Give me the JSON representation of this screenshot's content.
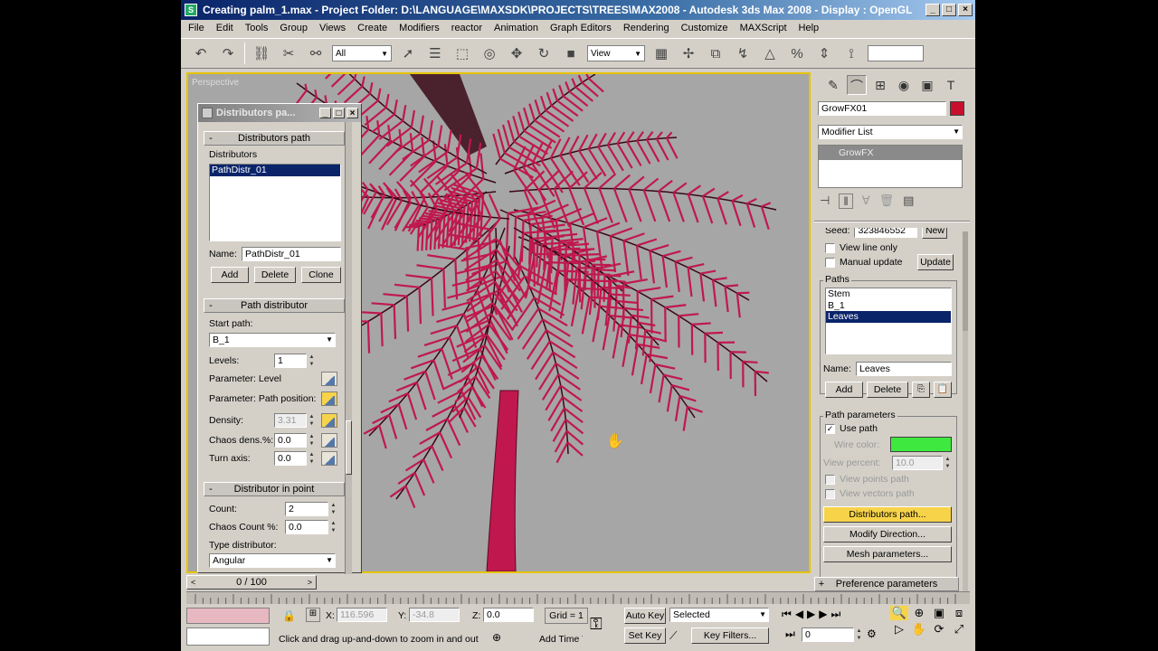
{
  "window": {
    "title": "Creating palm_1.max    - Project Folder: D:\\LANGUAGE\\MAXSDK\\PROJECTS\\TREES\\MAX2008    - Autodesk 3ds Max 2008    - Display : OpenGL",
    "app_icon": "S"
  },
  "menu": [
    "File",
    "Edit",
    "Tools",
    "Group",
    "Views",
    "Create",
    "Modifiers",
    "reactor",
    "Animation",
    "Graph Editors",
    "Rendering",
    "Customize",
    "MAXScript",
    "Help"
  ],
  "toolbar": {
    "selection_filter": "All",
    "ref_coord": "View"
  },
  "viewport": {
    "label": "Perspective",
    "foliage_color": "#c0184e",
    "background_color": "#a6a6a6"
  },
  "dialog": {
    "title": "Distributors pa...",
    "rollout1": {
      "header": "Distributors path",
      "list_label": "Distributors",
      "items": [
        "PathDistr_01"
      ],
      "name_label": "Name:",
      "name_value": "PathDistr_01",
      "add": "Add",
      "delete": "Delete",
      "clone": "Clone"
    },
    "rollout2": {
      "header": "Path distributor",
      "start_path_label": "Start path:",
      "start_path_value": "B_1",
      "levels_label": "Levels:",
      "levels_value": "1",
      "param_level": "Parameter: Level",
      "param_path_pos": "Parameter: Path position:",
      "density_label": "Density:",
      "density_value": "3.31",
      "chaos_dens_label": "Chaos dens.%:",
      "chaos_dens_value": "0.0",
      "turn_axis_label": "Turn axis:",
      "turn_axis_value": "0.0"
    },
    "rollout3": {
      "header": "Distributor in point",
      "count_label": "Count:",
      "count_value": "2",
      "chaos_count_label": "Chaos Count %:",
      "chaos_count_value": "0.0",
      "type_label": "Type distributor:",
      "type_value": "Angular"
    }
  },
  "command_panel": {
    "object_name": "GrowFX01",
    "object_color": "#c8102e",
    "modifier_list": "Modifier List",
    "stack_item": "GrowFX",
    "seed_label": "Seed:",
    "seed_value": "323846552",
    "new_btn": "New",
    "view_line_only": "View line only",
    "manual_update": "Manual update",
    "update_btn": "Update",
    "paths_label": "Paths",
    "paths": [
      "Stem",
      "B_1",
      "Leaves"
    ],
    "selected_path": "Leaves",
    "name_label": "Name:",
    "name_value": "Leaves",
    "add_btn": "Add",
    "delete_btn": "Delete",
    "path_params_label": "Path parameters",
    "use_path": "Use path",
    "wire_color_label": "Wire color:",
    "wire_color": "#3ee83e",
    "view_percent_label": "View percent:",
    "view_percent_value": "10.0",
    "view_points_path": "View points path",
    "view_vectors_path": "View vectors path",
    "distributors_path_btn": "Distributors path...",
    "modify_direction_btn": "Modify Direction...",
    "mesh_params_btn": "Mesh parameters...",
    "pref_params": "Preference parameters"
  },
  "timeline": {
    "frame": "0 / 100"
  },
  "status": {
    "x_label": "X:",
    "x_value": "116.596",
    "y_label": "Y:",
    "y_value": "-34.8",
    "z_label": "Z:",
    "z_value": "0.0",
    "grid": "Grid = 1",
    "auto_key": "Auto Key",
    "set_key": "Set Key",
    "selected": "Selected",
    "key_filters": "Key Filters...",
    "frame_field": "0",
    "prompt": "Click and drag up-and-down to zoom in and out",
    "add_time_tag": "Add Time Tag"
  }
}
